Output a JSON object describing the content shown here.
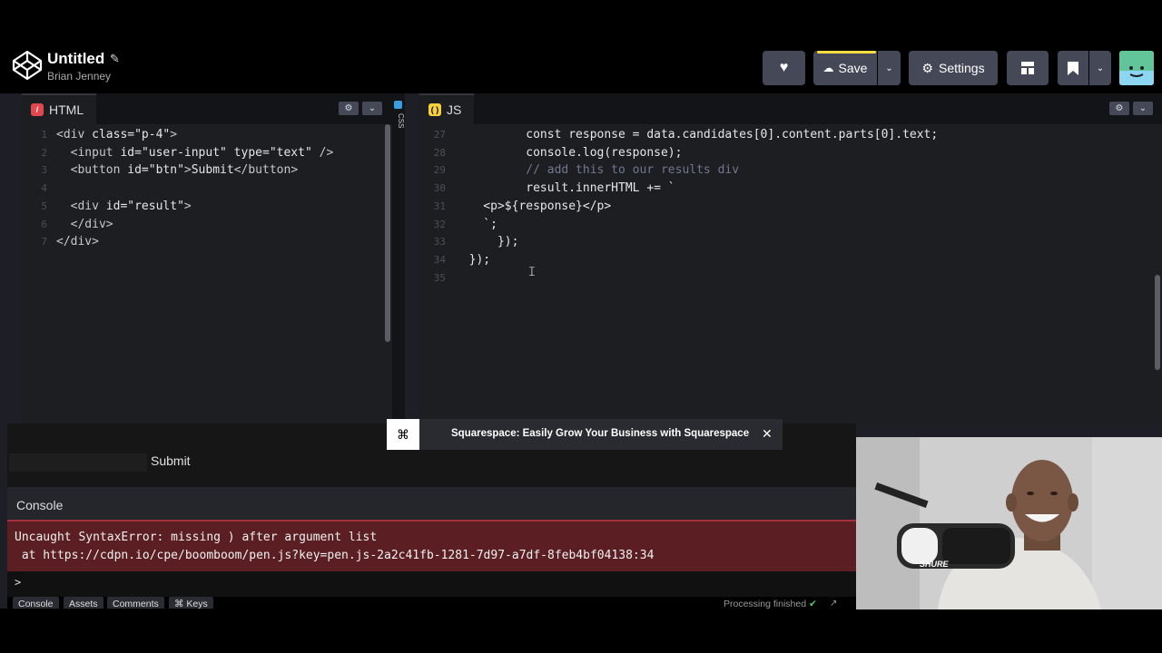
{
  "header": {
    "title": "Untitled",
    "author": "Brian Jenney",
    "save_label": "Save",
    "settings_label": "Settings"
  },
  "html_editor": {
    "tab_label": "HTML",
    "lines": [
      {
        "n": "1",
        "segments": [
          [
            "tag",
            "<div "
          ],
          [
            "attr",
            "class="
          ],
          [
            "str",
            "\"p-4\""
          ],
          [
            "tag",
            ">"
          ]
        ]
      },
      {
        "n": "2",
        "segments": [
          [
            "plain",
            "  "
          ],
          [
            "tag",
            "<input "
          ],
          [
            "attr",
            "id="
          ],
          [
            "str",
            "\"user-input\""
          ],
          [
            "attr",
            " type="
          ],
          [
            "str",
            "\"text\""
          ],
          [
            "tag",
            " />"
          ]
        ]
      },
      {
        "n": "3",
        "segments": [
          [
            "plain",
            "  "
          ],
          [
            "tag",
            "<button "
          ],
          [
            "attr",
            "id="
          ],
          [
            "str",
            "\"btn\""
          ],
          [
            "tag",
            ">"
          ],
          [
            "plain",
            "Submit"
          ],
          [
            "tag",
            "</button>"
          ]
        ]
      },
      {
        "n": "4",
        "segments": [
          [
            "plain",
            ""
          ]
        ]
      },
      {
        "n": "5",
        "segments": [
          [
            "plain",
            "  "
          ],
          [
            "tag",
            "<div "
          ],
          [
            "attr",
            "id="
          ],
          [
            "str",
            "\"result\""
          ],
          [
            "tag",
            ">"
          ]
        ]
      },
      {
        "n": "6",
        "segments": [
          [
            "plain",
            "  "
          ],
          [
            "tag",
            "</div>"
          ]
        ]
      },
      {
        "n": "7",
        "segments": [
          [
            "tag",
            "</div>"
          ]
        ]
      }
    ]
  },
  "css_editor": {
    "tab_label": "CSS"
  },
  "js_editor": {
    "tab_label": "JS",
    "lines": [
      {
        "n": "27",
        "segments": [
          [
            "plain",
            "          const response = data.candidates[0].content.parts[0].text;"
          ]
        ]
      },
      {
        "n": "28",
        "segments": [
          [
            "plain",
            "          console.log(response);"
          ]
        ]
      },
      {
        "n": "29",
        "segments": [
          [
            "comment",
            "          // add this to our results div"
          ]
        ]
      },
      {
        "n": "30",
        "segments": [
          [
            "plain",
            "          result.innerHTML += `"
          ]
        ]
      },
      {
        "n": "31",
        "segments": [
          [
            "plain",
            "    <p>${response}</p>"
          ]
        ]
      },
      {
        "n": "32",
        "segments": [
          [
            "plain",
            "    `;"
          ]
        ]
      },
      {
        "n": "33",
        "segments": [
          [
            "plain",
            "      });"
          ]
        ]
      },
      {
        "n": "34",
        "segments": [
          [
            "plain",
            "  });"
          ]
        ]
      },
      {
        "n": "35",
        "segments": [
          [
            "plain",
            ""
          ]
        ]
      }
    ]
  },
  "ad": {
    "text": "Squarespace: Easily Grow Your Business with Squarespace",
    "close": "✕"
  },
  "preview": {
    "submit_label": "Submit"
  },
  "console": {
    "title": "Console",
    "error_line1": "Uncaught SyntaxError: missing ) after argument list",
    "error_line2": " at https://cdpn.io/cpe/boomboom/pen.js?key=pen.js-2a2c41fb-1281-7d97-a7df-8feb4bf04138:34",
    "prompt": ">"
  },
  "footer": {
    "buttons": [
      "Console",
      "Assets",
      "Comments",
      "⌘ Keys"
    ],
    "status": "Processing finished"
  },
  "webcam": {
    "mic_brand": "SHURE"
  }
}
